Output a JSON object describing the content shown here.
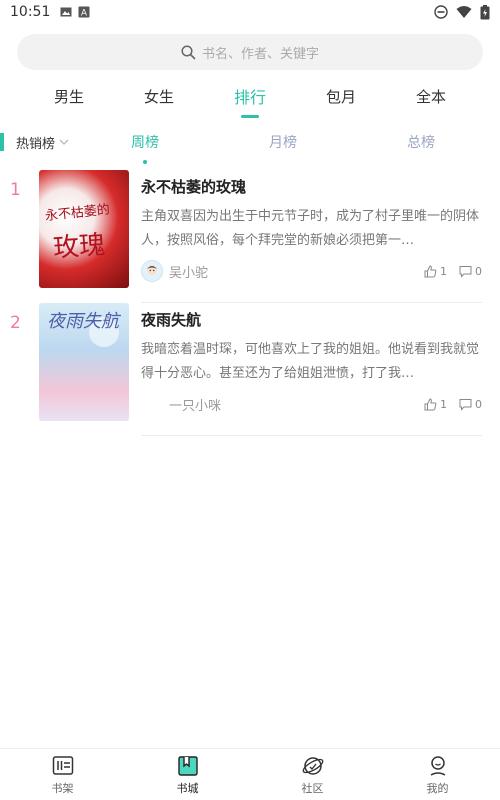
{
  "status_bar": {
    "time": "10:51",
    "icons_left": [
      "image-icon",
      "a-icon"
    ],
    "icons_right": [
      "dnd-icon",
      "wifi-icon",
      "battery-icon"
    ]
  },
  "search": {
    "placeholder": "书名、作者、关键字"
  },
  "main_tabs": [
    {
      "label": "男生",
      "active": false
    },
    {
      "label": "女生",
      "active": false
    },
    {
      "label": "排行",
      "active": true
    },
    {
      "label": "包月",
      "active": false
    },
    {
      "label": "全本",
      "active": false
    }
  ],
  "rank_filter": {
    "selected": "热销榜",
    "tabs": [
      {
        "label": "周榜",
        "active": true
      },
      {
        "label": "月榜",
        "active": false
      },
      {
        "label": "总榜",
        "active": false
      }
    ]
  },
  "books": [
    {
      "rank": "1",
      "title": "永不枯萎的玫瑰",
      "description": "主角双喜因为出生于中元节子时，成为了村子里唯一的阴体人，按照风俗，每个拜完堂的新娘必须把第一…",
      "author": "吴小驼",
      "likes": "1",
      "comments": "0",
      "cover_text_small": "永不枯萎的",
      "cover_text_big": "玫瑰"
    },
    {
      "rank": "2",
      "title": "夜雨失航",
      "description": "我暗恋着温时琛，可他喜欢上了我的姐姐。他说看到我就觉得十分恶心。甚至还为了给姐姐泄愤，打了我…",
      "author": "一只小咪",
      "likes": "1",
      "comments": "0",
      "cover_text": "夜雨失航"
    }
  ],
  "bottom_nav": [
    {
      "label": "书架",
      "icon": "bookshelf-icon",
      "active": false
    },
    {
      "label": "书城",
      "icon": "bookstore-icon",
      "active": true
    },
    {
      "label": "社区",
      "icon": "community-icon",
      "active": false
    },
    {
      "label": "我的",
      "icon": "profile-icon",
      "active": false
    }
  ],
  "colors": {
    "accent": "#2cc2a7",
    "rank_number": "#f07aa0",
    "inactive_subtab": "#9aa4c4"
  }
}
